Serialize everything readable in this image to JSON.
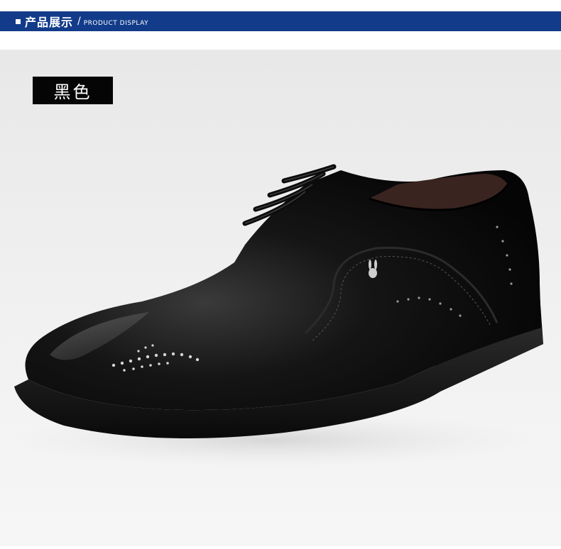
{
  "header": {
    "title_cn": "产品展示",
    "separator": "/",
    "title_en": "PRODUCT DISPLAY",
    "bar_color": "#123b8a"
  },
  "product": {
    "color_label": "黑色",
    "image_icon": "black-derby-shoe-image"
  }
}
